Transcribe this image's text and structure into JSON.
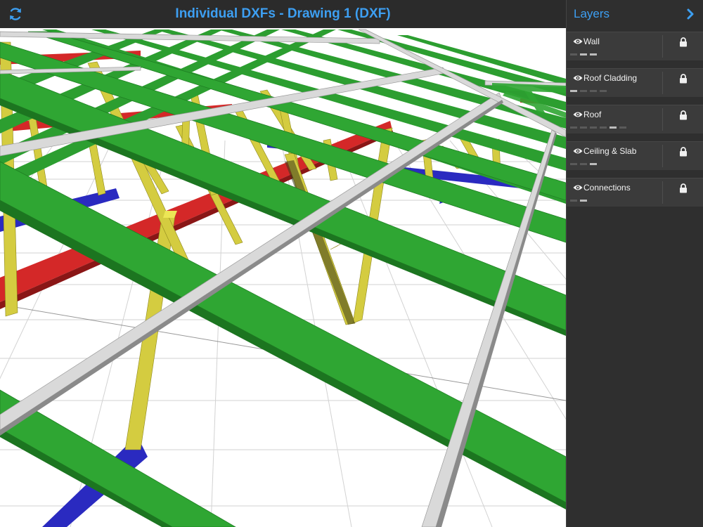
{
  "topbar": {
    "title": "Individual DXFs - Drawing 1 (DXF)",
    "refresh_icon": "refresh-icon",
    "accent_color": "#3d9ff2"
  },
  "panel": {
    "title": "Layers",
    "collapse_icon": "chevron-right-icon",
    "layers": [
      {
        "name": "Wall",
        "visible_icon": "eye-icon",
        "lock_icon": "lock-icon"
      },
      {
        "name": "Roof Cladding",
        "visible_icon": "eye-icon",
        "lock_icon": "lock-icon"
      },
      {
        "name": "Roof",
        "visible_icon": "eye-icon",
        "lock_icon": "lock-icon"
      },
      {
        "name": "Ceiling & Slab",
        "visible_icon": "eye-icon",
        "lock_icon": "lock-icon"
      },
      {
        "name": "Connections",
        "visible_icon": "eye-icon",
        "lock_icon": "lock-icon"
      }
    ]
  },
  "viewport": {
    "content": "3D roof framing model",
    "member_colors": {
      "rafters": "#27a32c",
      "battens": "#d4d4d4",
      "webs": "#d4cc40",
      "wall_plates": "#2a2ac0",
      "ceiling_beam": "#d42828"
    }
  }
}
